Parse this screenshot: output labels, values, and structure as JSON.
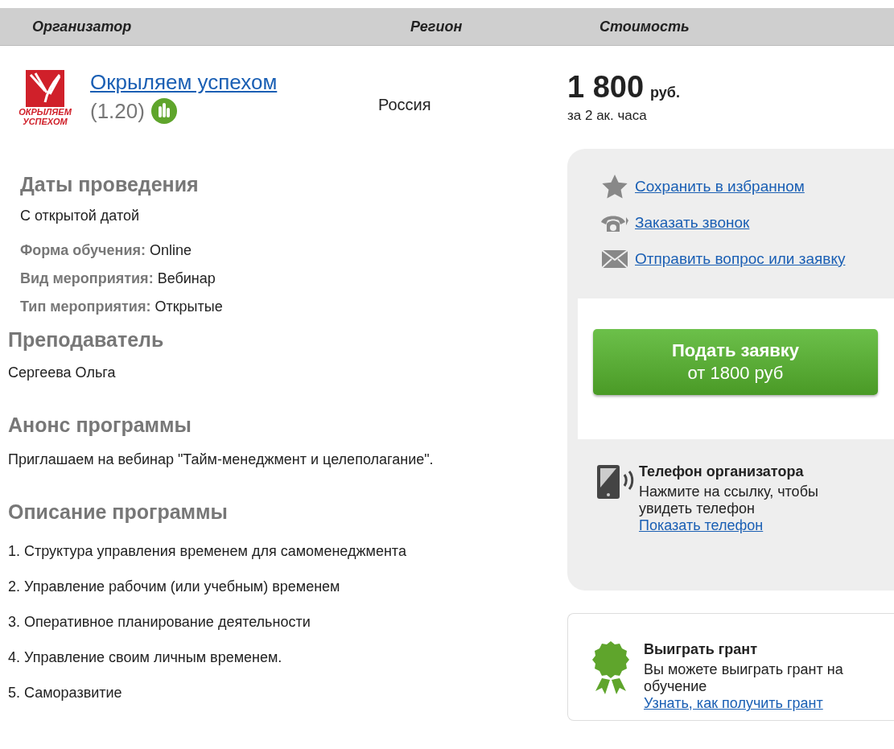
{
  "header": {
    "columns": [
      "Организатор",
      "Регион",
      "Стоимость"
    ]
  },
  "organizer": {
    "name": "Окрыляем успехом",
    "rating": "(1.20)",
    "logo_text": [
      "ОКРЫЛЯЕМ",
      "УСПЕХОМ"
    ]
  },
  "region": "Россия",
  "price": {
    "amount": "1 800",
    "currency": "руб.",
    "per": "за 2 ак. часа"
  },
  "dates": {
    "title": "Даты проведения",
    "value": "С открытой датой"
  },
  "properties": [
    {
      "label": "Форма обучения:",
      "value": "Online"
    },
    {
      "label": "Вид мероприятия:",
      "value": "Вебинар"
    },
    {
      "label": "Тип мероприятия:",
      "value": "Открытые"
    }
  ],
  "teacher": {
    "title": "Преподаватель",
    "name": "Сергеева Ольга"
  },
  "announce": {
    "title": "Анонс программы",
    "text": "Приглашаем на вебинар \"Тайм-менеджмент и целеполагание\"."
  },
  "description": {
    "title": "Описание программы",
    "items": [
      "1. Структура управления временем для самоменеджмента",
      "2. Управление рабочим (или учебным) временем",
      "3. Оперативное планирование деятельности",
      "4. Управление своим личным временем.",
      "5. Саморазвитие"
    ]
  },
  "actions": [
    {
      "kind": "star",
      "label": "Сохранить в избранном"
    },
    {
      "kind": "phone",
      "label": "Заказать звонок"
    },
    {
      "kind": "mail",
      "label": "Отправить вопрос или заявку"
    }
  ],
  "apply_button": {
    "title": "Подать заявку",
    "subtitle": "от 1800 руб"
  },
  "organizer_phone": {
    "title": "Телефон организатора",
    "text": "Нажмите на ссылку, чтобы увидеть телефон",
    "link": "Показать телефон"
  },
  "grant": {
    "title": "Выиграть грант",
    "text": "Вы можете выиграть грант на обучение",
    "link": "Узнать, как получить грант"
  }
}
